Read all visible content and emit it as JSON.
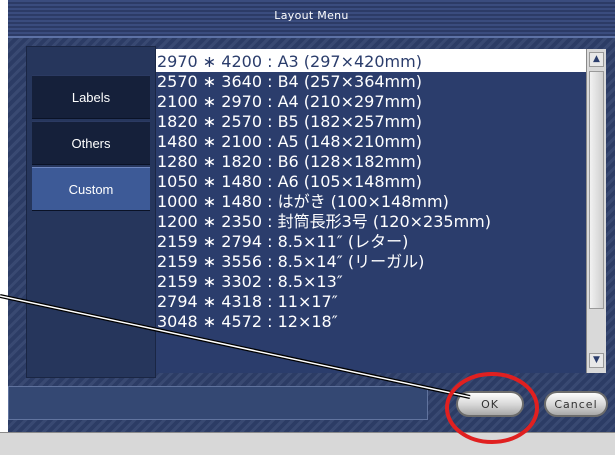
{
  "window": {
    "title": "Layout Menu"
  },
  "sidebar": {
    "items": [
      {
        "label": "Labels"
      },
      {
        "label": "Others"
      },
      {
        "label": "Custom"
      }
    ]
  },
  "list": {
    "items": [
      "2970 ∗ 4200 : A3 (297×420mm)",
      "2570 ∗ 3640 : B4 (257×364mm)",
      "2100 ∗ 2970 : A4 (210×297mm)",
      "1820 ∗ 2570 : B5 (182×257mm)",
      "1480 ∗ 2100 : A5 (148×210mm)",
      "1280 ∗ 1820 : B6 (128×182mm)",
      "1050 ∗ 1480 : A6 (105×148mm)",
      "1000 ∗ 1480 : はがき (100×148mm)",
      "1200 ∗ 2350 : 封筒長形3号 (120×235mm)",
      "2159 ∗ 2794 : 8.5×11″ (レター)",
      "2159 ∗ 3556 : 8.5×14″ (リーガル)",
      "2159 ∗ 3302 : 8.5×13″",
      "2794 ∗ 4318 : 11×17″",
      "3048 ∗ 4572 : 12×18″"
    ]
  },
  "buttons": {
    "ok_label": "OK",
    "cancel_label": "Cancel"
  },
  "colors": {
    "dialog_bg": "#2e3f6a",
    "list_row_bg": "#2b3d6c",
    "annotation": "#e02020"
  },
  "icons": {
    "scroll_up": "scroll-up-arrow-icon",
    "scroll_down": "scroll-down-arrow-icon"
  }
}
